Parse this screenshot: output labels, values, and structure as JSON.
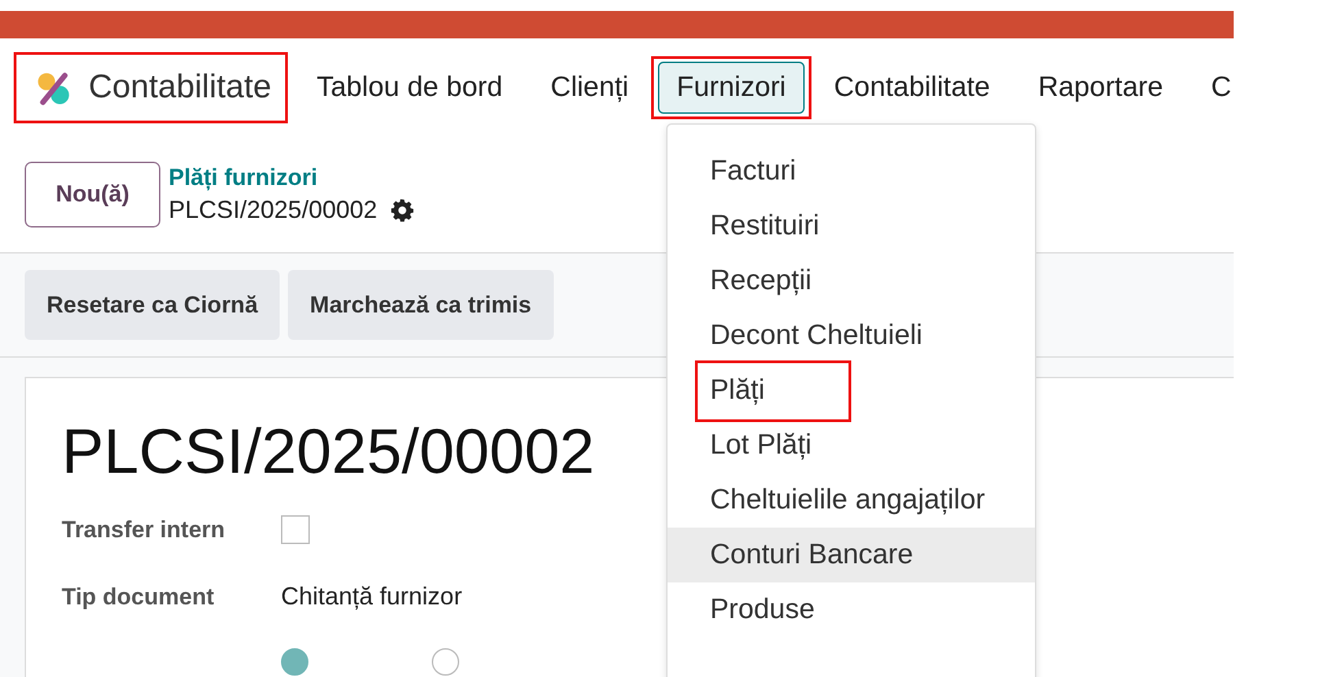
{
  "app": {
    "name": "Contabilitate",
    "annotated": true
  },
  "nav": [
    {
      "label": "Tablou de bord",
      "open": false,
      "annotated": false
    },
    {
      "label": "Clienți",
      "open": false,
      "annotated": false
    },
    {
      "label": "Furnizori",
      "open": true,
      "annotated": true
    },
    {
      "label": "Contabilitate",
      "open": false,
      "annotated": false
    },
    {
      "label": "Raportare",
      "open": false,
      "annotated": false
    },
    {
      "label": "C",
      "open": false,
      "annotated": false
    }
  ],
  "new_button": "Nou(ă)",
  "breadcrumb": {
    "parent": "Plăți furnizori",
    "current": "PLCSI/2025/00002"
  },
  "actions": [
    "Resetare ca Ciornă",
    "Marchează ca trimis"
  ],
  "record": {
    "title": "PLCSI/2025/00002",
    "fields": [
      {
        "kind": "checkbox",
        "label": "Transfer intern",
        "checked": false
      },
      {
        "kind": "text",
        "label": "Tip document",
        "value": "Chitanță furnizor"
      }
    ],
    "radios": [
      {
        "selected": true
      },
      {
        "selected": false
      }
    ]
  },
  "dropdown": [
    {
      "label": "Facturi",
      "hovered": false,
      "annotated": false
    },
    {
      "label": "Restituiri",
      "hovered": false,
      "annotated": false
    },
    {
      "label": "Recepții",
      "hovered": false,
      "annotated": false
    },
    {
      "label": "Decont Cheltuieli",
      "hovered": false,
      "annotated": false
    },
    {
      "label": "Plăți",
      "hovered": false,
      "annotated": true
    },
    {
      "label": "Lot Plăți",
      "hovered": false,
      "annotated": false
    },
    {
      "label": "Cheltuielile angajaților",
      "hovered": false,
      "annotated": false
    },
    {
      "label": "Conturi Bancare",
      "hovered": true,
      "annotated": false
    },
    {
      "label": "Produse",
      "hovered": false,
      "annotated": false
    }
  ]
}
